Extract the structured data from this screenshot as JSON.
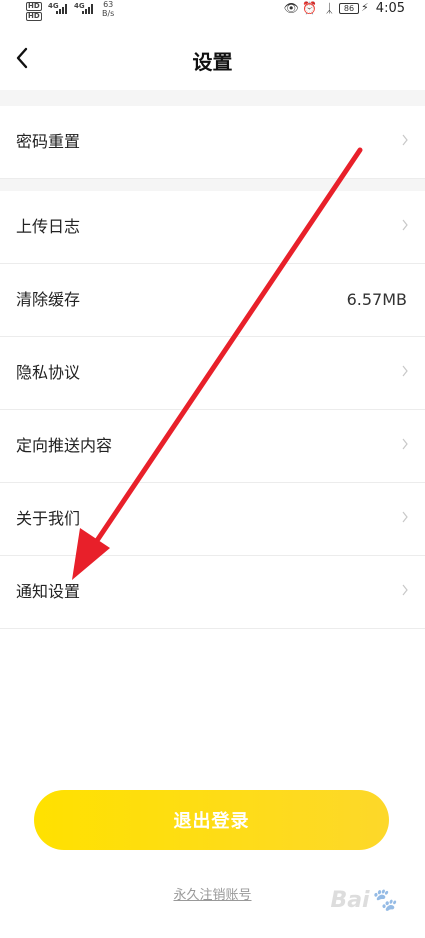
{
  "status_bar": {
    "network_1": "4G",
    "network_2": "4G",
    "hd_1": "HD",
    "hd_2": "HD",
    "speed_value": "63",
    "speed_unit": "B/s",
    "battery": "86",
    "time": "4:05"
  },
  "header": {
    "title": "设置"
  },
  "menu": {
    "items": [
      {
        "label": "密码重置"
      },
      {
        "label": "上传日志"
      },
      {
        "label": "清除缓存",
        "value": "6.57MB"
      },
      {
        "label": "隐私协议"
      },
      {
        "label": "定向推送内容"
      },
      {
        "label": "关于我们"
      },
      {
        "label": "通知设置"
      }
    ]
  },
  "logout_button": "退出登录",
  "delete_account": "永久注销账号",
  "colors": {
    "accent": "#ffe100",
    "arrow": "#e8202a"
  }
}
